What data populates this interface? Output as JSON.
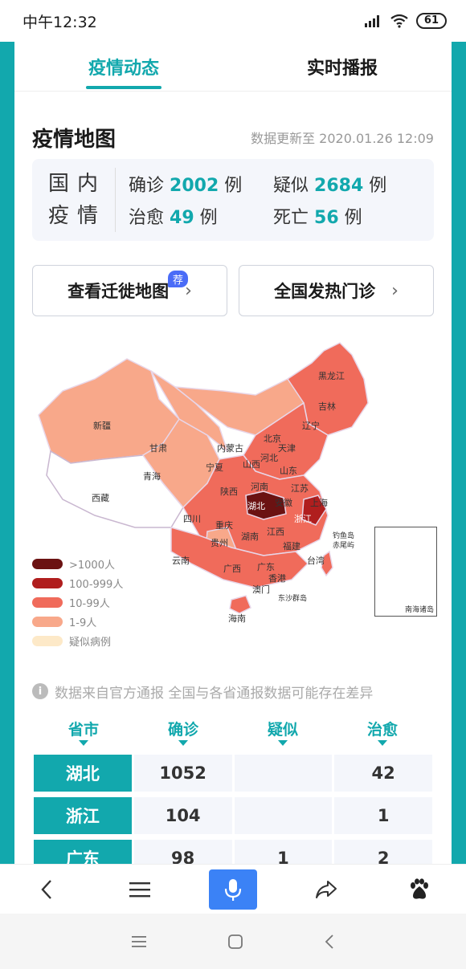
{
  "status_bar": {
    "time": "中午12:32",
    "battery": "61"
  },
  "tabs": [
    {
      "label": "疫情动态",
      "active": true
    },
    {
      "label": "实时播报",
      "active": false
    }
  ],
  "section": {
    "title": "疫情地图",
    "update": "数据更新至 2020.01.26 12:09"
  },
  "summary": {
    "label_line1": "国内",
    "label_line2": "疫情",
    "confirmed_label": "确诊",
    "confirmed": "2002",
    "confirmed_unit": "例",
    "suspected_label": "疑似",
    "suspected": "2684",
    "suspected_unit": "例",
    "cured_label": "治愈",
    "cured": "49",
    "cured_unit": "例",
    "dead_label": "死亡",
    "dead": "56",
    "dead_unit": "例"
  },
  "buttons": {
    "migration": "查看迁徙地图",
    "migration_badge": "荐",
    "fever_clinic": "全国发热门诊"
  },
  "map": {
    "regions": [
      "新疆",
      "西藏",
      "青海",
      "甘肃",
      "内蒙古",
      "宁夏",
      "陕西",
      "四川",
      "重庆",
      "云南",
      "贵州",
      "广西",
      "广东",
      "海南",
      "湖南",
      "湖北",
      "河南",
      "山西",
      "河北",
      "北京",
      "天津",
      "山东",
      "江苏",
      "安徽",
      "上海",
      "浙江",
      "江西",
      "福建",
      "台湾",
      "香港",
      "澳门",
      "辽宁",
      "吉林",
      "黑龙江",
      "钓鱼岛",
      "赤尾屿",
      "东沙群岛"
    ],
    "legend": [
      {
        "label": ">1000人",
        "color": "#6b1212"
      },
      {
        "label": "100-999人",
        "color": "#b01e1e"
      },
      {
        "label": "10-99人",
        "color": "#f06b5b"
      },
      {
        "label": "1-9人",
        "color": "#f8a88a"
      },
      {
        "label": "疑似病例",
        "color": "#fde9c8"
      }
    ],
    "inset_label": "南海诸岛"
  },
  "note": "数据来自官方通报 全国与各省通报数据可能存在差异",
  "table": {
    "headers": [
      "省市",
      "确诊",
      "疑似",
      "治愈"
    ],
    "rows": [
      [
        "湖北",
        "1052",
        "",
        "42"
      ],
      [
        "浙江",
        "104",
        "",
        "1"
      ],
      [
        "广东",
        "98",
        "1",
        "2"
      ]
    ]
  },
  "colors": {
    "accent": "#12a8ad",
    "mic": "#3b82f6"
  }
}
